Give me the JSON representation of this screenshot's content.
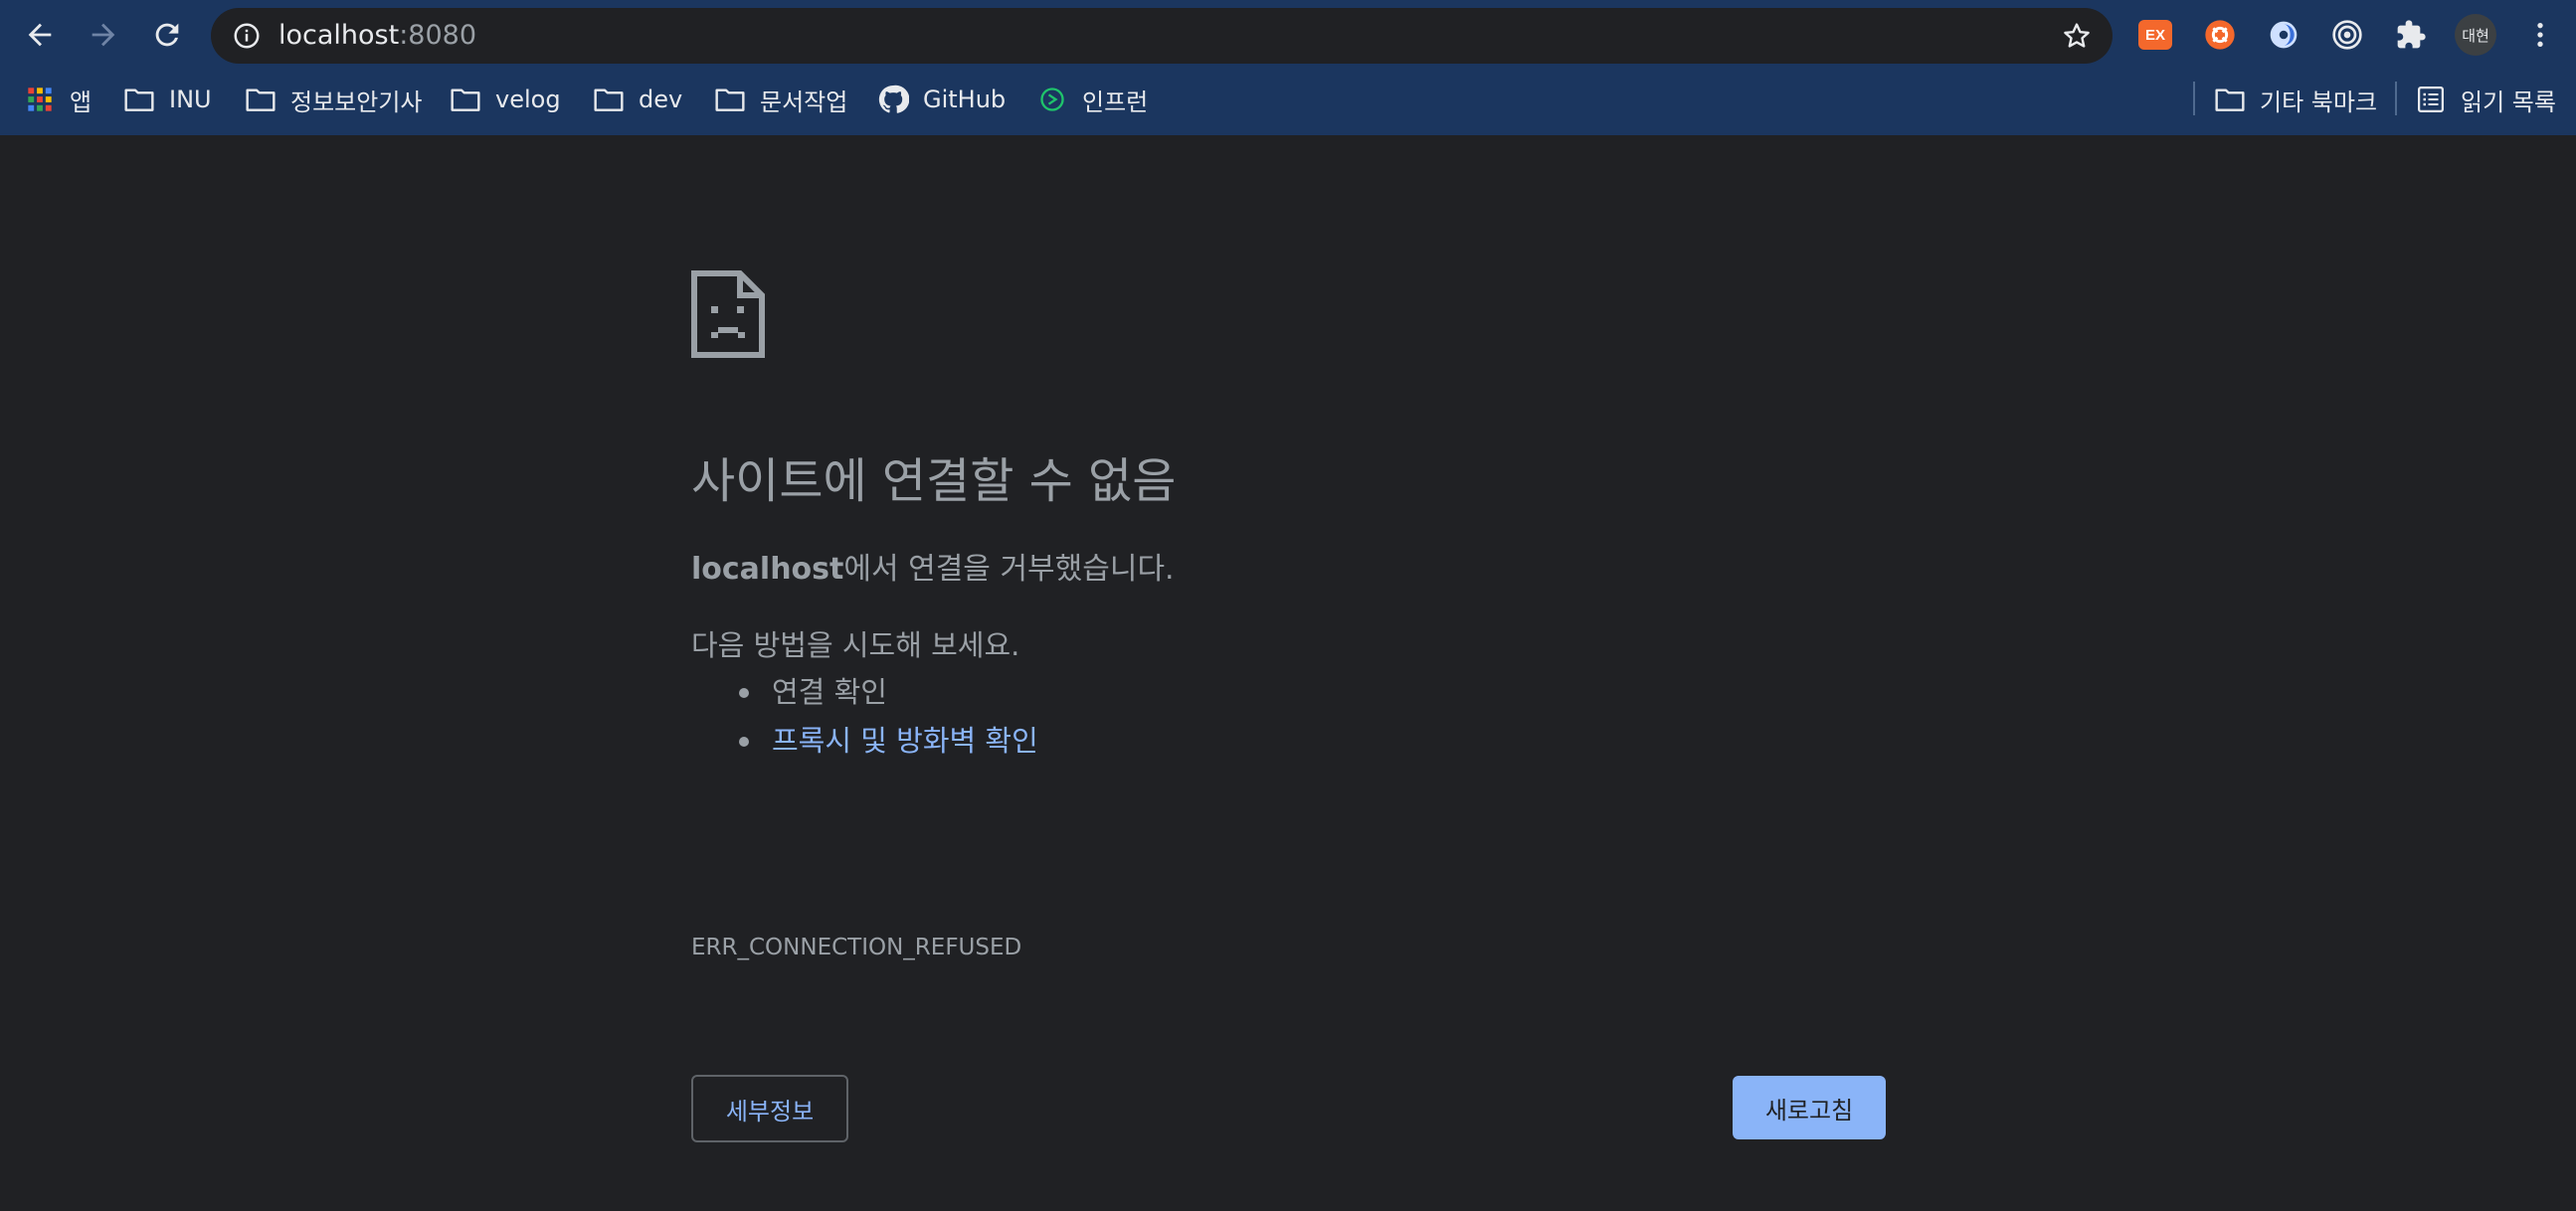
{
  "toolbar": {
    "omnibox": {
      "host": "localhost",
      "port": ":8080"
    },
    "extensions": [
      {
        "name": "ex-extension-icon",
        "label": "EX",
        "color": "#f4682c"
      },
      {
        "name": "orange-extension-icon",
        "color": "#f4682c"
      },
      {
        "name": "lens-extension-icon",
        "color": "#cfe0ff"
      },
      {
        "name": "target-extension-icon",
        "color": "#e8eaed"
      },
      {
        "name": "puzzle-extension-icon",
        "color": "#e8eaed"
      }
    ],
    "profile_label": "대현"
  },
  "bookmarks": {
    "items": [
      {
        "label": "앱",
        "icon": "apps-grid-icon"
      },
      {
        "label": "INU",
        "icon": "folder-icon"
      },
      {
        "label": "정보보안기사",
        "icon": "folder-icon"
      },
      {
        "label": "velog",
        "icon": "folder-icon"
      },
      {
        "label": "dev",
        "icon": "folder-icon"
      },
      {
        "label": "문서작업",
        "icon": "folder-icon"
      },
      {
        "label": "GitHub",
        "icon": "github-icon"
      },
      {
        "label": "인프런",
        "icon": "inflearn-icon"
      }
    ],
    "other_bookmarks": "기타 북마크",
    "reading_list": "읽기 목록"
  },
  "error": {
    "title": "사이트에 연결할 수 없음",
    "host": "localhost",
    "refused_suffix": "에서 연결을 거부했습니다.",
    "suggestion_heading": "다음 방법을 시도해 보세요.",
    "suggestions": [
      "연결 확인",
      "프록시 및 방화벽 확인"
    ],
    "code": "ERR_CONNECTION_REFUSED",
    "details_button": "세부정보",
    "reload_button": "새로고침"
  },
  "colors": {
    "toolbar_bg": "#1b365f",
    "page_bg": "#202124",
    "text_muted": "#9aa0a6",
    "link": "#8ab4f8"
  }
}
